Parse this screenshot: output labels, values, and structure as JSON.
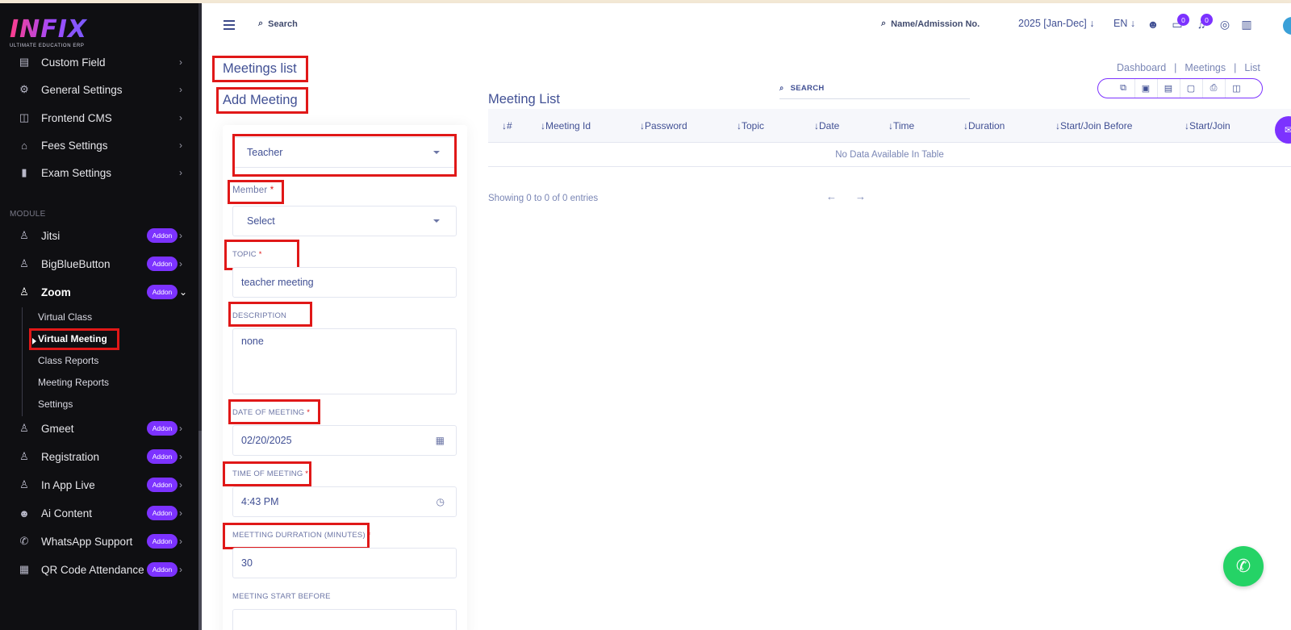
{
  "sidebar": {
    "logo": {
      "main": "INFIX",
      "sub": "ULTIMATE EDUCATION ERP"
    },
    "items_top": [
      {
        "label": "Custom Field",
        "icon": "custom-field-icon"
      },
      {
        "label": "General Settings",
        "icon": "gear-icon"
      },
      {
        "label": "Frontend CMS",
        "icon": "cms-icon"
      },
      {
        "label": "Fees Settings",
        "icon": "bank-icon"
      },
      {
        "label": "Exam Settings",
        "icon": "book-icon"
      }
    ],
    "module_label": "MODULE",
    "modules": [
      {
        "label": "Jitsi",
        "addon": "Addon"
      },
      {
        "label": "BigBlueButton",
        "addon": "Addon"
      },
      {
        "label": "Zoom",
        "addon": "Addon"
      },
      {
        "label": "Gmeet",
        "addon": "Addon"
      },
      {
        "label": "Registration",
        "addon": "Addon"
      },
      {
        "label": "In App Live",
        "addon": "Addon"
      },
      {
        "label": "Ai Content",
        "addon": "Addon"
      },
      {
        "label": "WhatsApp Support",
        "addon": "Addon"
      },
      {
        "label": "QR Code Attendance",
        "addon": "Addon"
      }
    ],
    "zoom_sub": [
      "Virtual Class",
      "Virtual Meeting",
      "Class Reports",
      "Meeting Reports",
      "Settings"
    ]
  },
  "header": {
    "search_label": "Search",
    "search2_label": "Name/Admission No.",
    "year": "2025 [Jan-Dec]",
    "lang": "EN",
    "chat_badge": "0",
    "notif_badge": "0"
  },
  "page": {
    "title": "Meetings list",
    "breadcrumb": [
      "Dashboard",
      "Meetings",
      "List"
    ]
  },
  "form": {
    "title": "Add Meeting",
    "role_value": "Teacher",
    "member_label": "Member",
    "member_value": "Select",
    "topic_label": "TOPIC",
    "topic_value": "teacher meeting",
    "description_label": "DESCRIPTION",
    "description_value": "none",
    "date_label": "DATE OF MEETING",
    "date_value": "02/20/2025",
    "time_label": "TIME OF MEETING",
    "time_value": "4:43 PM",
    "duration_label": "MEETTING DURRATION (MINUTES)",
    "duration_value": "30",
    "start_before_label": "MEETING START BEFORE",
    "required_mark": "*"
  },
  "list": {
    "title": "Meeting List",
    "search_label": "SEARCH",
    "columns": [
      "#",
      "Meeting Id",
      "Password",
      "Topic",
      "Date",
      "Time",
      "Duration",
      "Start/Join Before",
      "Start/Join"
    ],
    "empty_text": "No Data Available In Table",
    "showing_text": "Showing 0 to 0 of 0 entries"
  },
  "colors": {
    "accent": "#7c32ff",
    "sidebar_bg": "#0f0f12",
    "text_primary": "#415094",
    "highlight": "#e01818",
    "whatsapp": "#25d366"
  }
}
